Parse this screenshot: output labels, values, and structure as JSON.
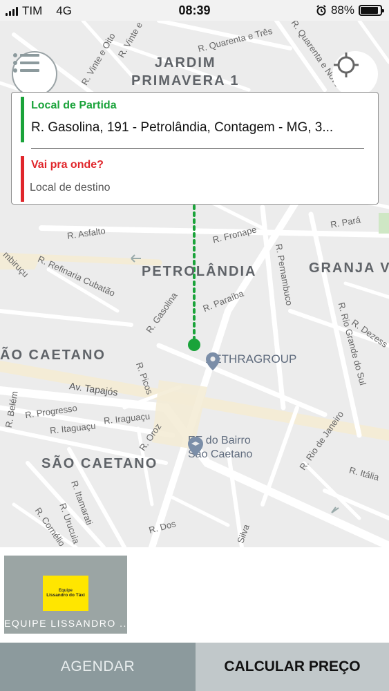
{
  "status_bar": {
    "carrier": "TIM",
    "network": "4G",
    "time": "08:39",
    "battery_percent": "88%",
    "battery_level": 0.88
  },
  "map": {
    "areas": {
      "jardim_primavera": "JARDIM\nPRIMAVERA 1",
      "petrolandia": "PETROLÂNDIA",
      "granja": "GRANJA V",
      "sao_caetano_top": "ÃO CAETANO",
      "sao_caetano": "SÃO CAETANO"
    },
    "streets": {
      "quarenta_e_tres": "R. Quarenta e Três",
      "quarenta_e_nove": "R. Quarenta e Nove",
      "vinte_e_oito": "R. Vinte e Oito",
      "vinte_e_seis": "R. Vinte e",
      "asfalto": "R. Asfalto",
      "fronape": "R. Fronape",
      "para": "R. Pará",
      "refinaria_cubatao": "R. Refinaria Cubatão",
      "pernambuco": "R. Pernambuco",
      "gasolina": "R. Gasolina",
      "paraiba": "R. Paraíba",
      "rio_grande_do_sul": "R. Rio Grande do Sul",
      "dezesseis": "R. Dezess",
      "tapajos": "Av. Tapajós",
      "picos": "R. Picos",
      "progresso": "R. Progresso",
      "iraguacu": "R. Iraguaçu",
      "itaguacu": "R. Itaguaçu",
      "orozimbo": "R. Oroz",
      "belem": "R. Belém",
      "rio_de_janeiro": "R. Rio de Janeiro",
      "italia": "R. Itália",
      "itamarati": "R. Itamarati",
      "urucuia": "R. Urucuia",
      "cornelio": "R. Cornélio",
      "dos": "R. Dos",
      "silva": "Silva",
      "cubatao_left": "mbiruçu",
      "gasolina_top": "R. Gasol"
    },
    "pois": {
      "aethragroup": "AETHRAGROUP",
      "school": "EE do Bairro\nSão Caetano"
    },
    "route_color": "#1aa33a"
  },
  "address_card": {
    "origin_title": "Local de Partida",
    "origin_address": "R. Gasolina, 191 - Petrolândia, Contagem - MG, 3...",
    "destination_title": "Vai pra onde?",
    "destination_placeholder": "Local de destino"
  },
  "team": {
    "logo_line1": "Equipe",
    "logo_line2": "Lissandro do Táxi",
    "name": "EQUIPE LISSANDRO ..."
  },
  "actions": {
    "schedule_label": "AGENDAR",
    "price_label": "CALCULAR PREÇO"
  },
  "icons": {
    "menu": "menu-list-icon",
    "locate": "crosshair-icon",
    "alarm": "alarm-icon",
    "poi": "place-pin-icon",
    "school": "school-pin-icon"
  },
  "colors": {
    "origin": "#1aa33a",
    "destination": "#e0262b",
    "schedule_button": "#8c9a9d",
    "price_button": "#c1c8ca",
    "logo_yellow": "#ffe600"
  }
}
